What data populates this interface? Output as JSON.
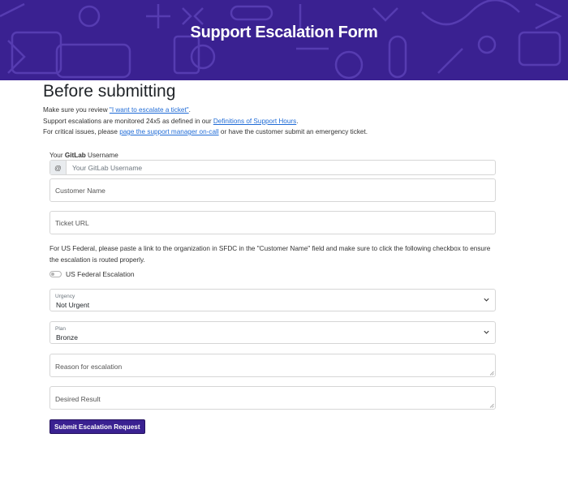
{
  "banner": {
    "title": "Support Escalation Form",
    "background": "#3a2191"
  },
  "intro": {
    "heading": "Before submitting",
    "line1_prefix": "Make sure you review ",
    "line1_link": "\"I want to escalate a ticket\"",
    "line1_suffix": ".",
    "line2_prefix": "Support escalations are monitored 24x5 as defined in our ",
    "line2_link": "Definitions of Support Hours",
    "line2_suffix": ".",
    "line3_prefix": "For critical issues, please ",
    "line3_link": "page the support manager on-call",
    "line3_suffix": " or have the customer submit an emergency ticket."
  },
  "form": {
    "username_label_prefix": "Your ",
    "username_label_bold": "GitLab",
    "username_label_suffix": " Username",
    "username_addon": "@",
    "username_placeholder": "Your GitLab Username",
    "customer_name_placeholder": "Customer Name",
    "ticket_url_placeholder": "Ticket URL",
    "federal_note": "For US Federal, please paste a link to the organization in SFDC in the \"Customer Name\" field and make sure to click the following checkbox to ensure the escalation is routed properly.",
    "federal_toggle_label": "US Federal Escalation",
    "federal_toggle_checked": false,
    "urgency_label": "Urgency",
    "urgency_value": "Not Urgent",
    "plan_label": "Plan",
    "plan_value": "Bronze",
    "reason_placeholder": "Reason for escalation",
    "desired_result_placeholder": "Desired Result",
    "submit_label": "Submit Escalation Request",
    "link_color": "#1f6bd6",
    "submit_color": "#3a2191"
  }
}
